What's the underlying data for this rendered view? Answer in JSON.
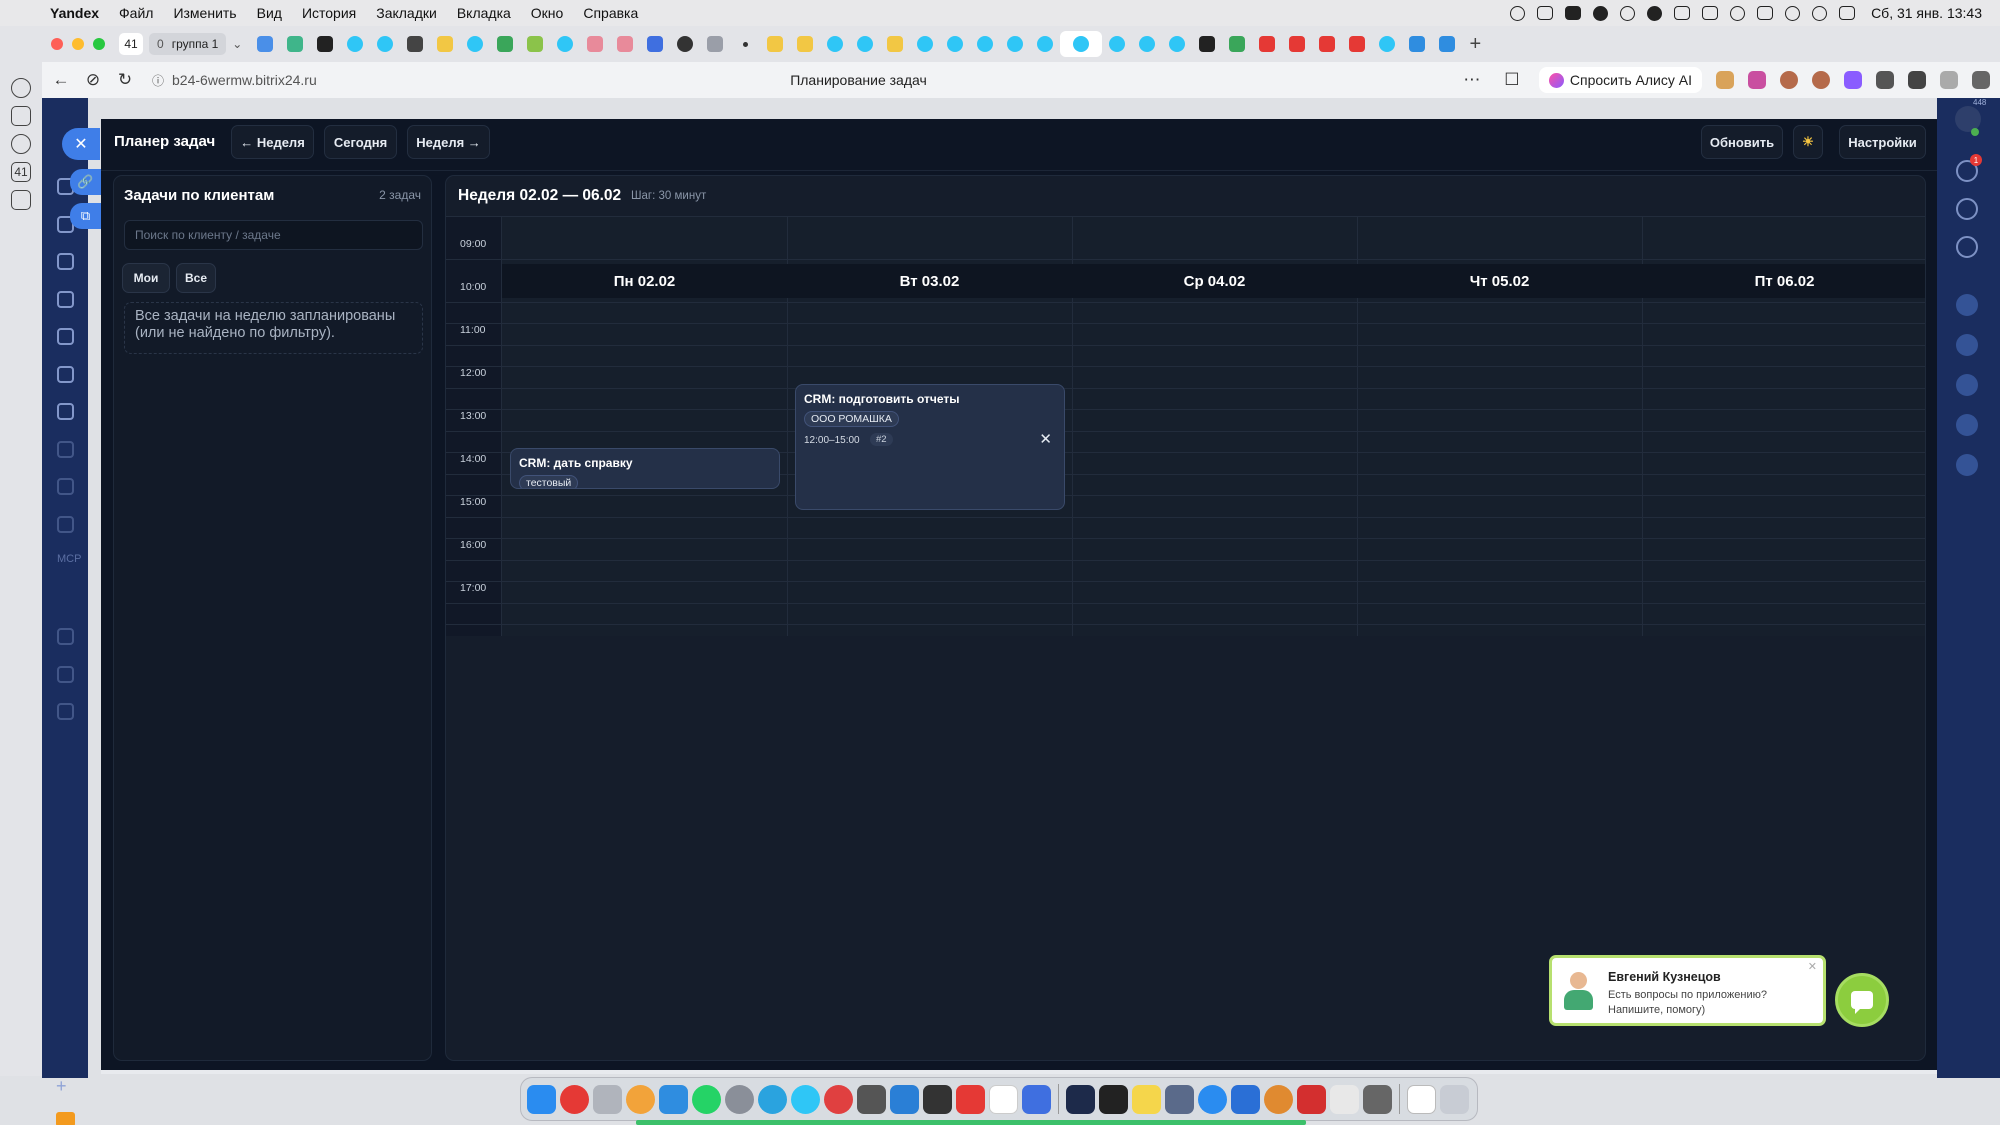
{
  "os_menubar": {
    "app_name": "Yandex",
    "items": [
      "Файл",
      "Изменить",
      "Вид",
      "История",
      "Закладки",
      "Вкладка",
      "Окно",
      "Справка"
    ],
    "clock": "Сб, 31 янв. 13:43"
  },
  "browser": {
    "tab_count": "41",
    "group": {
      "count": "0",
      "name": "группа 1"
    },
    "url": "b24-6wermw.bitrix24.ru",
    "page_title": "Планирование задач",
    "alice_label": "Спросить Алису AI",
    "sidebar_badge": "41"
  },
  "bitrix": {
    "left_menu_labels": [
      "MCP"
    ],
    "notification_count": "1",
    "top_right_counter": "448"
  },
  "app": {
    "title": "Планер задач",
    "nav": {
      "prev_week": "← Неделя",
      "today": "Сегодня",
      "next_week": "Неделя →"
    },
    "refresh": "Обновить",
    "theme_icon": "☀",
    "settings": "Настройки"
  },
  "clients_panel": {
    "title": "Задачи по клиентам",
    "count": "2 задач",
    "search_placeholder": "Поиск по клиенту / задаче",
    "filters": {
      "mine": "Мои",
      "all": "Все"
    },
    "empty_message": "Все задачи на неделю запланированы (или не найдено по фильтру)."
  },
  "calendar": {
    "week_title": "Неделя 02.02 — 06.02",
    "step_label": "Шаг: 30 минут",
    "times": [
      "09:00",
      "10:00",
      "11:00",
      "12:00",
      "13:00",
      "14:00",
      "15:00",
      "16:00",
      "17:00"
    ],
    "days": [
      "Пн 02.02",
      "Вт 03.02",
      "Ср 04.02",
      "Чт 05.02",
      "Пт 06.02"
    ],
    "events": [
      {
        "day": "Пн 02.02",
        "title": "CRM: дать справку",
        "client": "тестовый"
      },
      {
        "day": "Вт 03.02",
        "title": "CRM: подготовить отчеты",
        "client": "ООО РОМАШКА",
        "time": "12:00–15:00",
        "id": "#2"
      }
    ]
  },
  "chat_popup": {
    "name": "Евгений Кузнецов",
    "message": "Есть вопросы по приложению? Напишите, помогу)"
  }
}
